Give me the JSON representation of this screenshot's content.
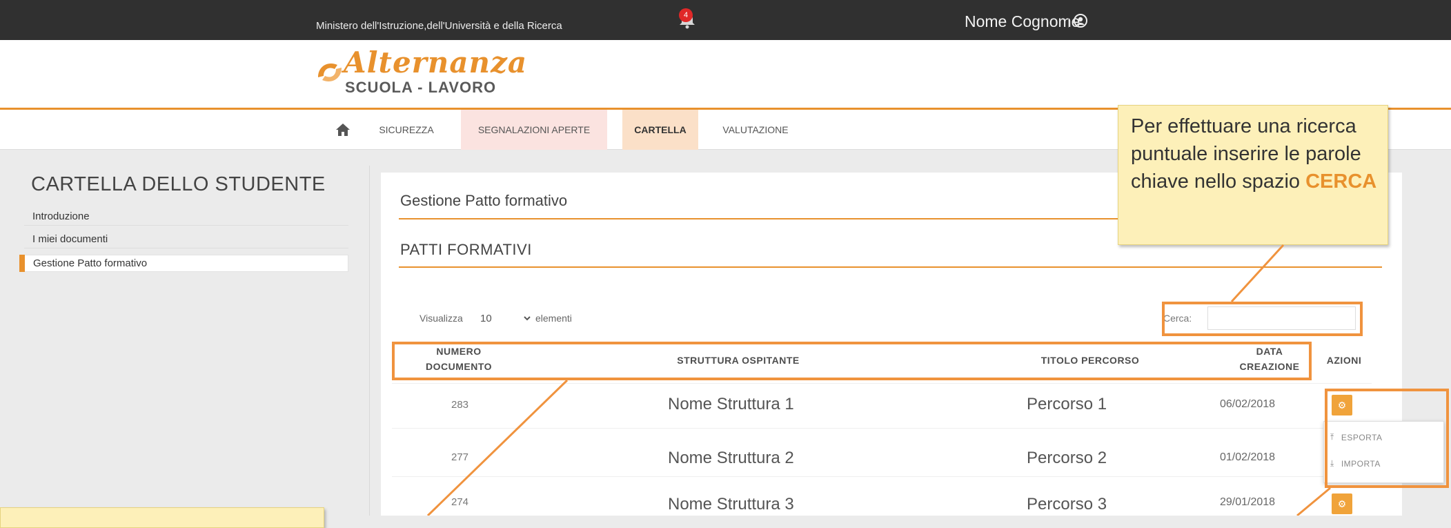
{
  "header": {
    "ministry": "Ministero dell'Istruzione,dell'Università e della Ricerca",
    "notification_count": "4",
    "user_name": "Nome Cognome"
  },
  "logo": {
    "script": "Alternanza",
    "subtitle": "SCUOLA - LAVORO"
  },
  "nav": {
    "tabs": [
      {
        "label": "SICUREZZA"
      },
      {
        "label": "SEGNALAZIONI APERTE"
      },
      {
        "label": "CARTELLA"
      },
      {
        "label": "VALUTAZIONE"
      }
    ]
  },
  "sidebar": {
    "title": "CARTELLA DELLO STUDENTE",
    "items": [
      {
        "label": "Introduzione"
      },
      {
        "label": "I miei documenti"
      },
      {
        "label": "Gestione Patto formativo"
      }
    ]
  },
  "main": {
    "panel_title": "Gestione Patto formativo",
    "section_title": "PATTI FORMATIVI",
    "show_prefix": "Visualizza",
    "show_value": "10",
    "show_suffix": "elementi",
    "search_label": "Cerca:",
    "columns": {
      "numero_line1": "NUMERO",
      "numero_line2": "DOCUMENTO",
      "struttura": "STRUTTURA OSPITANTE",
      "titolo": "TITOLO PERCORSO",
      "data_line1": "DATA",
      "data_line2": "CREAZIONE",
      "azioni": "AZIONI"
    },
    "rows": [
      {
        "numero": "283",
        "struttura": "Nome Struttura 1",
        "titolo": "Percorso 1",
        "data": "06/02/2018"
      },
      {
        "numero": "277",
        "struttura": "Nome Struttura 2",
        "titolo": "Percorso 2",
        "data": "01/02/2018"
      },
      {
        "numero": "274",
        "struttura": "Nome Struttura 3",
        "titolo": "Percorso 3",
        "data": "29/01/2018"
      }
    ],
    "actions_menu": {
      "export": "ESPORTA",
      "import": "IMPORTA"
    }
  },
  "callout": {
    "text": "Per effettuare una ricerca puntuale inserire le parole chiave nello spazio",
    "emphasis": "CERCA"
  },
  "colors": {
    "accent": "#e8912d",
    "topbar": "#303030",
    "callout_bg": "#fdf0b9"
  }
}
